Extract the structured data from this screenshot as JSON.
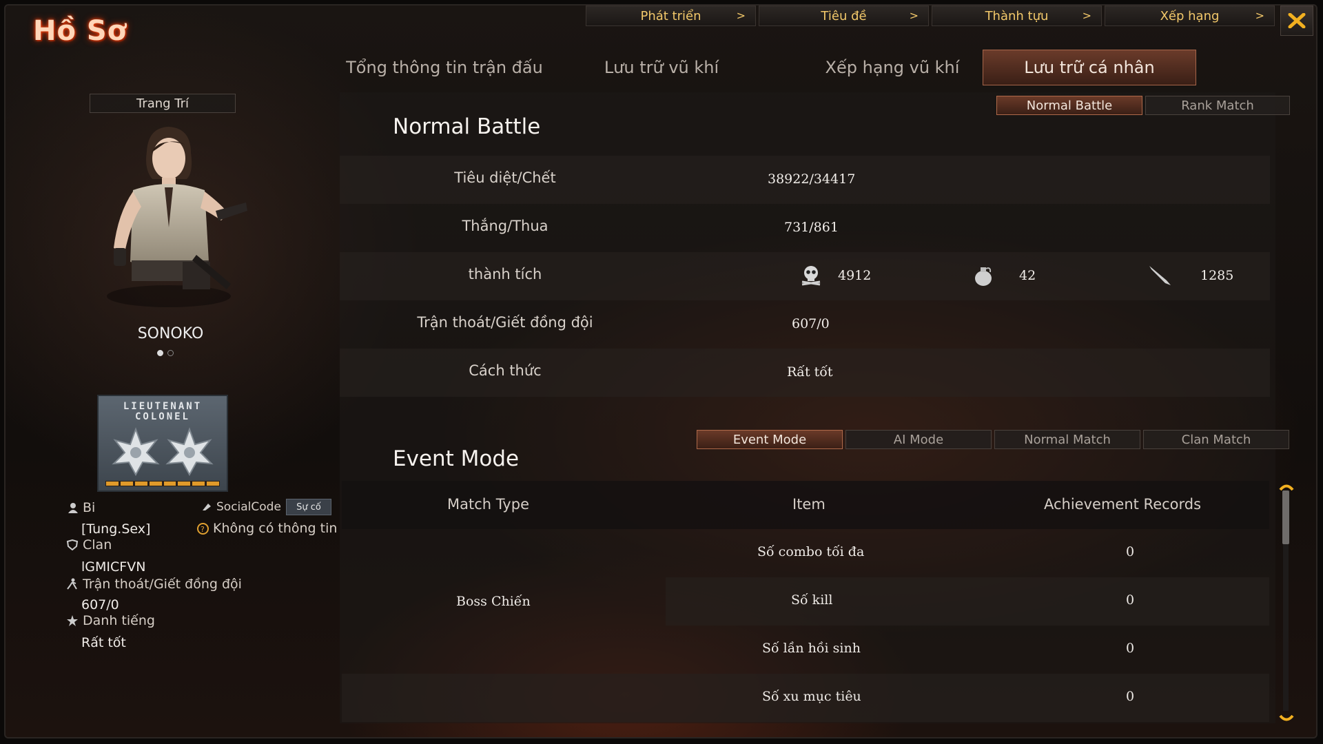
{
  "window": {
    "title": "Hồ Sơ"
  },
  "top_nav": [
    {
      "label": "Phát triển",
      "chevron": ">"
    },
    {
      "label": "Tiêu đề",
      "chevron": ">"
    },
    {
      "label": "Thành tựu",
      "chevron": ">"
    },
    {
      "label": "Xếp hạng",
      "chevron": ">"
    }
  ],
  "tabs": [
    {
      "label": "Tổng thông tin trận đấu",
      "active": false
    },
    {
      "label": "Lưu trữ vũ khí",
      "active": false
    },
    {
      "label": "Xếp hạng vũ khí",
      "active": false
    },
    {
      "label": "Lưu trữ cá nhân",
      "active": true
    }
  ],
  "profile": {
    "decoration_label": "Trang Trí",
    "character_name": "SONOKO",
    "rank_line1": "LIEUTENANT",
    "rank_line2": "COLONEL",
    "nickname_label": "Bi",
    "social_label": "SocialCode",
    "social_button": "Sự cố",
    "nickname_value": "[Tung.Sex]",
    "social_value": "Không có thông tin",
    "clan_label": "Clan",
    "clan_value": "lGMICFVN",
    "escape_label": "Trận thoát/Giết đồng đội",
    "escape_value": "607/0",
    "reputation_label": "Danh tiếng",
    "reputation_value": "Rất tốt"
  },
  "battle_toggle": [
    {
      "label": "Normal Battle",
      "active": true
    },
    {
      "label": "Rank Match",
      "active": false
    }
  ],
  "normal_battle": {
    "title": "Normal Battle",
    "rows": {
      "kd_label": "Tiêu diệt/Chết",
      "kd_value": "38922/34417",
      "wl_label": "Thắng/Thua",
      "wl_value": "731/861",
      "achv_label": "thành tích",
      "headshot": "4912",
      "grenade": "42",
      "knife": "1285",
      "escape_label": "Trận thoát/Giết đồng đội",
      "escape_value": "607/0",
      "manner_label": "Cách thức",
      "manner_value": "Rất tốt"
    }
  },
  "event_mode": {
    "title": "Event Mode",
    "mode_buttons": [
      {
        "label": "Event Mode",
        "active": true
      },
      {
        "label": "AI Mode",
        "active": false
      },
      {
        "label": "Normal Match",
        "active": false
      },
      {
        "label": "Clan Match",
        "active": false
      }
    ],
    "table": {
      "headers": [
        "Match Type",
        "Item",
        "Achievement Records"
      ],
      "match_type": "Boss Chiến",
      "rows": [
        {
          "item": "Số combo tối đa",
          "value": "0"
        },
        {
          "item": "Số kill",
          "value": "0"
        },
        {
          "item": "Số lần hồi sinh",
          "value": "0"
        },
        {
          "item": "Số xu mục tiêu",
          "value": "0"
        }
      ]
    }
  },
  "colors": {
    "accent": "#f2c86a",
    "active_tab": "#6a3b2a",
    "scroll_arrow": "#f2b020"
  },
  "icons": [
    "close-icon",
    "chevron-right-icon",
    "skull-icon",
    "grenade-icon",
    "knife-icon",
    "user-icon",
    "social-icon",
    "question-icon",
    "clan-icon",
    "escape-icon",
    "reputation-icon",
    "scroll-up-icon",
    "scroll-down-icon"
  ]
}
